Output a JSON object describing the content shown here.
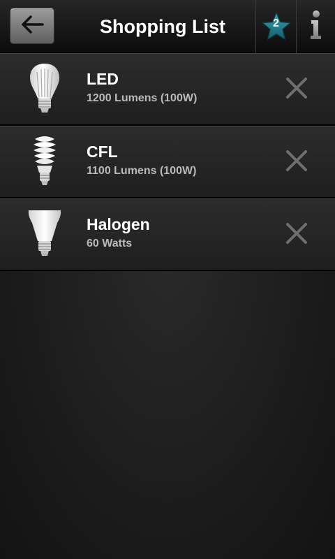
{
  "header": {
    "title": "Shopping List",
    "back_icon": "arrow-left-icon",
    "favorites": {
      "icon": "star-icon",
      "count": "2",
      "color": "#1e7a8a"
    },
    "info_icon": "info-icon"
  },
  "items": [
    {
      "name": "LED",
      "spec": "1200 Lumens (100W)",
      "icon": "led-bulb-icon"
    },
    {
      "name": "CFL",
      "spec": "1100 Lumens (100W)",
      "icon": "cfl-bulb-icon"
    },
    {
      "name": "Halogen",
      "spec": "60 Watts",
      "icon": "halogen-bulb-icon"
    }
  ],
  "remove_icon": "close-icon"
}
